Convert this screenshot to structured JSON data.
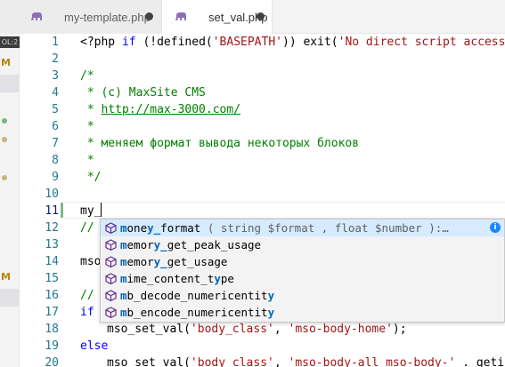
{
  "tabs": [
    {
      "label": "my-template.php",
      "active": false,
      "dirty": true
    },
    {
      "label": "set_val.php",
      "active": true,
      "dirty": true
    }
  ],
  "left_strip": {
    "badge": "OL:2",
    "markers": [
      "M",
      "M"
    ]
  },
  "current_line": 11,
  "line_numbers": [
    "1",
    "2",
    "3",
    "4",
    "5",
    "6",
    "7",
    "8",
    "9",
    "10",
    "11",
    "12",
    "13",
    "14",
    "15",
    "16",
    "17",
    "18",
    "19",
    "20"
  ],
  "code": {
    "l1": {
      "open": "<?php ",
      "if": "if",
      "p1": " (!defined(",
      "s1": "'BASEPATH'",
      "p2": ")) exit(",
      "s2": "'No direct script access"
    },
    "l3": "/*",
    "l4": " * (c) MaxSite CMS",
    "l5_prefix": " * ",
    "l5_link": "http://max-3000.com/",
    "l6": " *",
    "l7": " * меняем формат вывода некоторых блоков",
    "l8": " *",
    "l9": " */",
    "l11": "my_",
    "l12": "//",
    "l14": "mso",
    "l16": "//",
    "l17": "if",
    "l18": {
      "fn": "mso_set_val(",
      "s1": "'body_class'",
      "sep": ", ",
      "s2": "'mso-body-home'",
      "end": ");"
    },
    "l19": "else",
    "l20": {
      "fn": "mso set val(",
      "s1": "'body class'",
      "sep": ", ",
      "s2": "'mso-body-all mso-body-'",
      "end": " . getin"
    }
  },
  "suggestions": [
    {
      "pre": "",
      "hl1": "m",
      "mid1": "one",
      "hl2": "y_",
      "rest": "format",
      "detail": "  ( string $format , float $number ):…",
      "selected": true
    },
    {
      "pre": "",
      "hl1": "m",
      "mid1": "emor",
      "hl2": "y_",
      "rest": "get_peak_usage",
      "detail": "",
      "selected": false
    },
    {
      "pre": "",
      "hl1": "m",
      "mid1": "emor",
      "hl2": "y_",
      "rest": "get_usage",
      "detail": "",
      "selected": false
    },
    {
      "pre": "",
      "hl1": "m",
      "mid1": "ime_content_t",
      "hl2": "y",
      "rest": "pe",
      "detail": "",
      "selected": false
    },
    {
      "pre": "",
      "hl1": "m",
      "mid1": "b_decode_numericentit",
      "hl2": "y",
      "rest": "",
      "detail": "",
      "selected": false
    },
    {
      "pre": "",
      "hl1": "m",
      "mid1": "b_encode_numericentit",
      "hl2": "y",
      "rest": "",
      "detail": "",
      "selected": false
    }
  ],
  "info_glyph": "i",
  "colors": {
    "keyword": "#0000ff",
    "string": "#a31515",
    "comment": "#008000",
    "line_number": "#237893",
    "match": "#0066bf",
    "icon": "#652d90"
  }
}
